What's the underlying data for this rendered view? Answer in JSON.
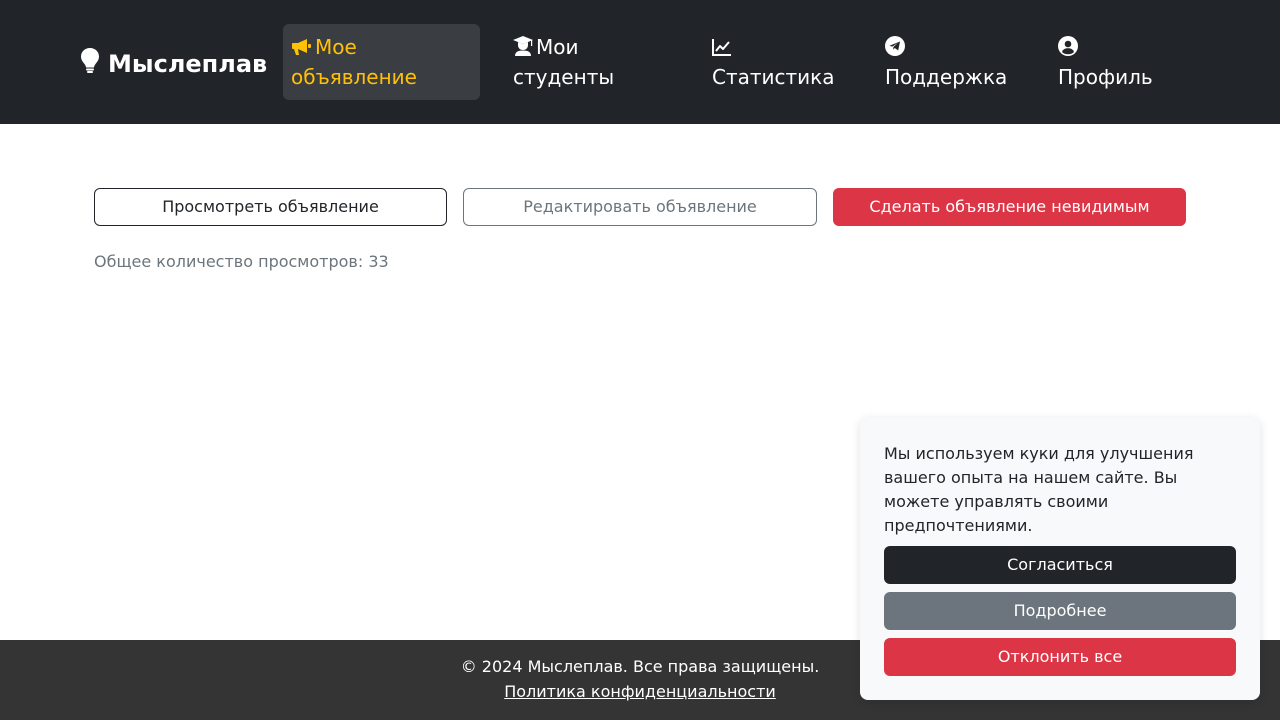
{
  "brand": {
    "name": "Мыслеплав",
    "icon": "lightbulb-icon"
  },
  "nav": {
    "items": [
      {
        "label": "Мое объявление",
        "icon": "megaphone-icon",
        "active": true
      },
      {
        "label": "Мои студенты",
        "icon": "graduate-icon",
        "active": false
      },
      {
        "label": "Статистика",
        "icon": "chart-line-icon",
        "active": false
      },
      {
        "label": "Поддержка",
        "icon": "telegram-icon",
        "active": false
      },
      {
        "label": "Профиль",
        "icon": "user-circle-icon",
        "active": false
      }
    ]
  },
  "actions": {
    "view_label": "Просмотреть объявление",
    "edit_label": "Редактировать объявление",
    "hide_label": "Сделать объявление невидимым"
  },
  "stats": {
    "views_text": "Общее количество просмотров: 33"
  },
  "footer": {
    "copyright": "© 2024 Мыслеплав. Все права защищены.",
    "privacy_link": "Политика конфиденциальности"
  },
  "cookie": {
    "message": "Мы используем куки для улучшения вашего опыта на нашем сайте. Вы можете управлять своими предпочтениями.",
    "agree_label": "Согласиться",
    "more_label": "Подробнее",
    "reject_label": "Отклонить все"
  },
  "colors": {
    "navbar": "#212529",
    "active_accent": "#ffc107",
    "danger": "#dc3545",
    "secondary": "#6c757d",
    "footer": "#343434"
  }
}
